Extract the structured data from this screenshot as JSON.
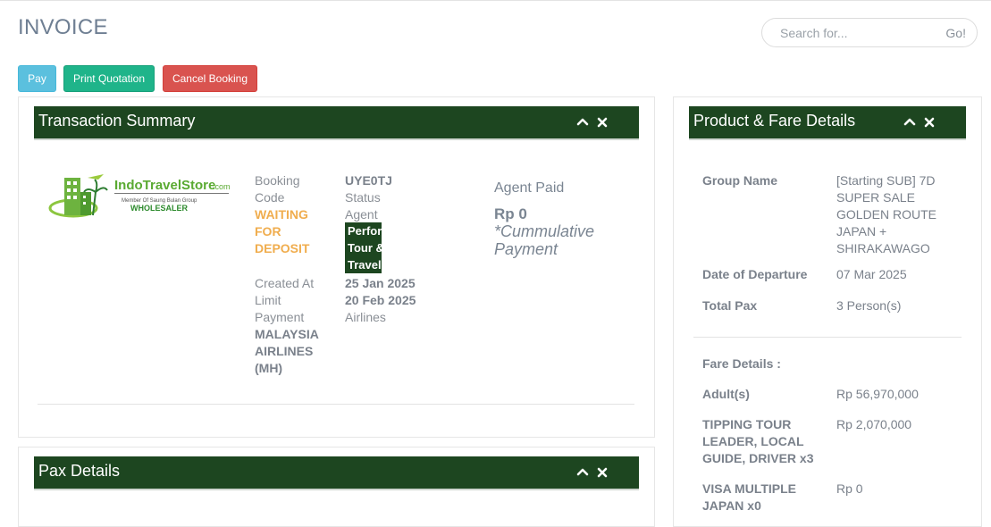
{
  "header": {
    "title": "INVOICE",
    "search": {
      "placeholder": "Search for...",
      "go_label": "Go!"
    }
  },
  "actions": {
    "pay": "Pay",
    "print_quotation": "Print Quotation",
    "cancel_booking": "Cancel Booking"
  },
  "transaction_summary": {
    "title": "Transaction Summary",
    "logo": {
      "brand": "IndoTravelStore",
      "brand_suffix": ".com",
      "tagline": "Member Of Saung Bulan Group",
      "sub": "WHOLESALER"
    },
    "labels": {
      "booking_code_1": "Booking",
      "booking_code_2": "Code",
      "status": "Status",
      "agent": "Agent",
      "created_at": "Created At",
      "limit_payment_1": "Limit",
      "limit_payment_2": "Payment",
      "airlines": "Airlines"
    },
    "values": {
      "booking_code": "UYE0TJ",
      "status_1": "WAITING",
      "status_2": "FOR",
      "status_3": "DEPOSIT",
      "agent_1": "Performa",
      "agent_2": "Tour &",
      "agent_3": "Travel",
      "created_at": "25 Jan 2025",
      "limit_payment": "20 Feb 2025",
      "airline_1": "MALAYSIA",
      "airline_2": "AIRLINES",
      "airline_3": "(MH)"
    },
    "agent_paid": {
      "label": "Agent Paid",
      "amount": "Rp 0",
      "note": "*Cummulative Payment"
    }
  },
  "pax_details": {
    "title": "Pax Details"
  },
  "product_fare": {
    "title": "Product & Fare Details",
    "group_name_label": "Group Name",
    "group_name_1": "[Starting SUB] 7D",
    "group_name_2": "SUPER SALE",
    "group_name_3": "GOLDEN ROUTE",
    "group_name_4": "JAPAN +",
    "group_name_5": "SHIRAKAWAGO",
    "departure_label": "Date of Departure",
    "departure_value": "07 Mar 2025",
    "total_pax_label": "Total Pax",
    "total_pax_value": "3 Person(s)",
    "fare_details_label": "Fare Details :",
    "adult_label": "Adult(s)",
    "adult_value": "Rp 56,970,000",
    "tipping_1": "TIPPING TOUR",
    "tipping_2": "LEADER, LOCAL",
    "tipping_3": "GUIDE, DRIVER x3",
    "tipping_value": "Rp 2,070,000",
    "visa_1": "VISA MULTIPLE",
    "visa_2": "JAPAN x0",
    "visa_value": "Rp 0"
  },
  "colors": {
    "panel_header": "#1d4620",
    "pay": "#5bc0de",
    "print": "#1fb48a",
    "cancel": "#d9534f",
    "warning": "#f0ad4e"
  },
  "icons": [
    "chevron-up-icon",
    "close-icon",
    "search-go"
  ]
}
